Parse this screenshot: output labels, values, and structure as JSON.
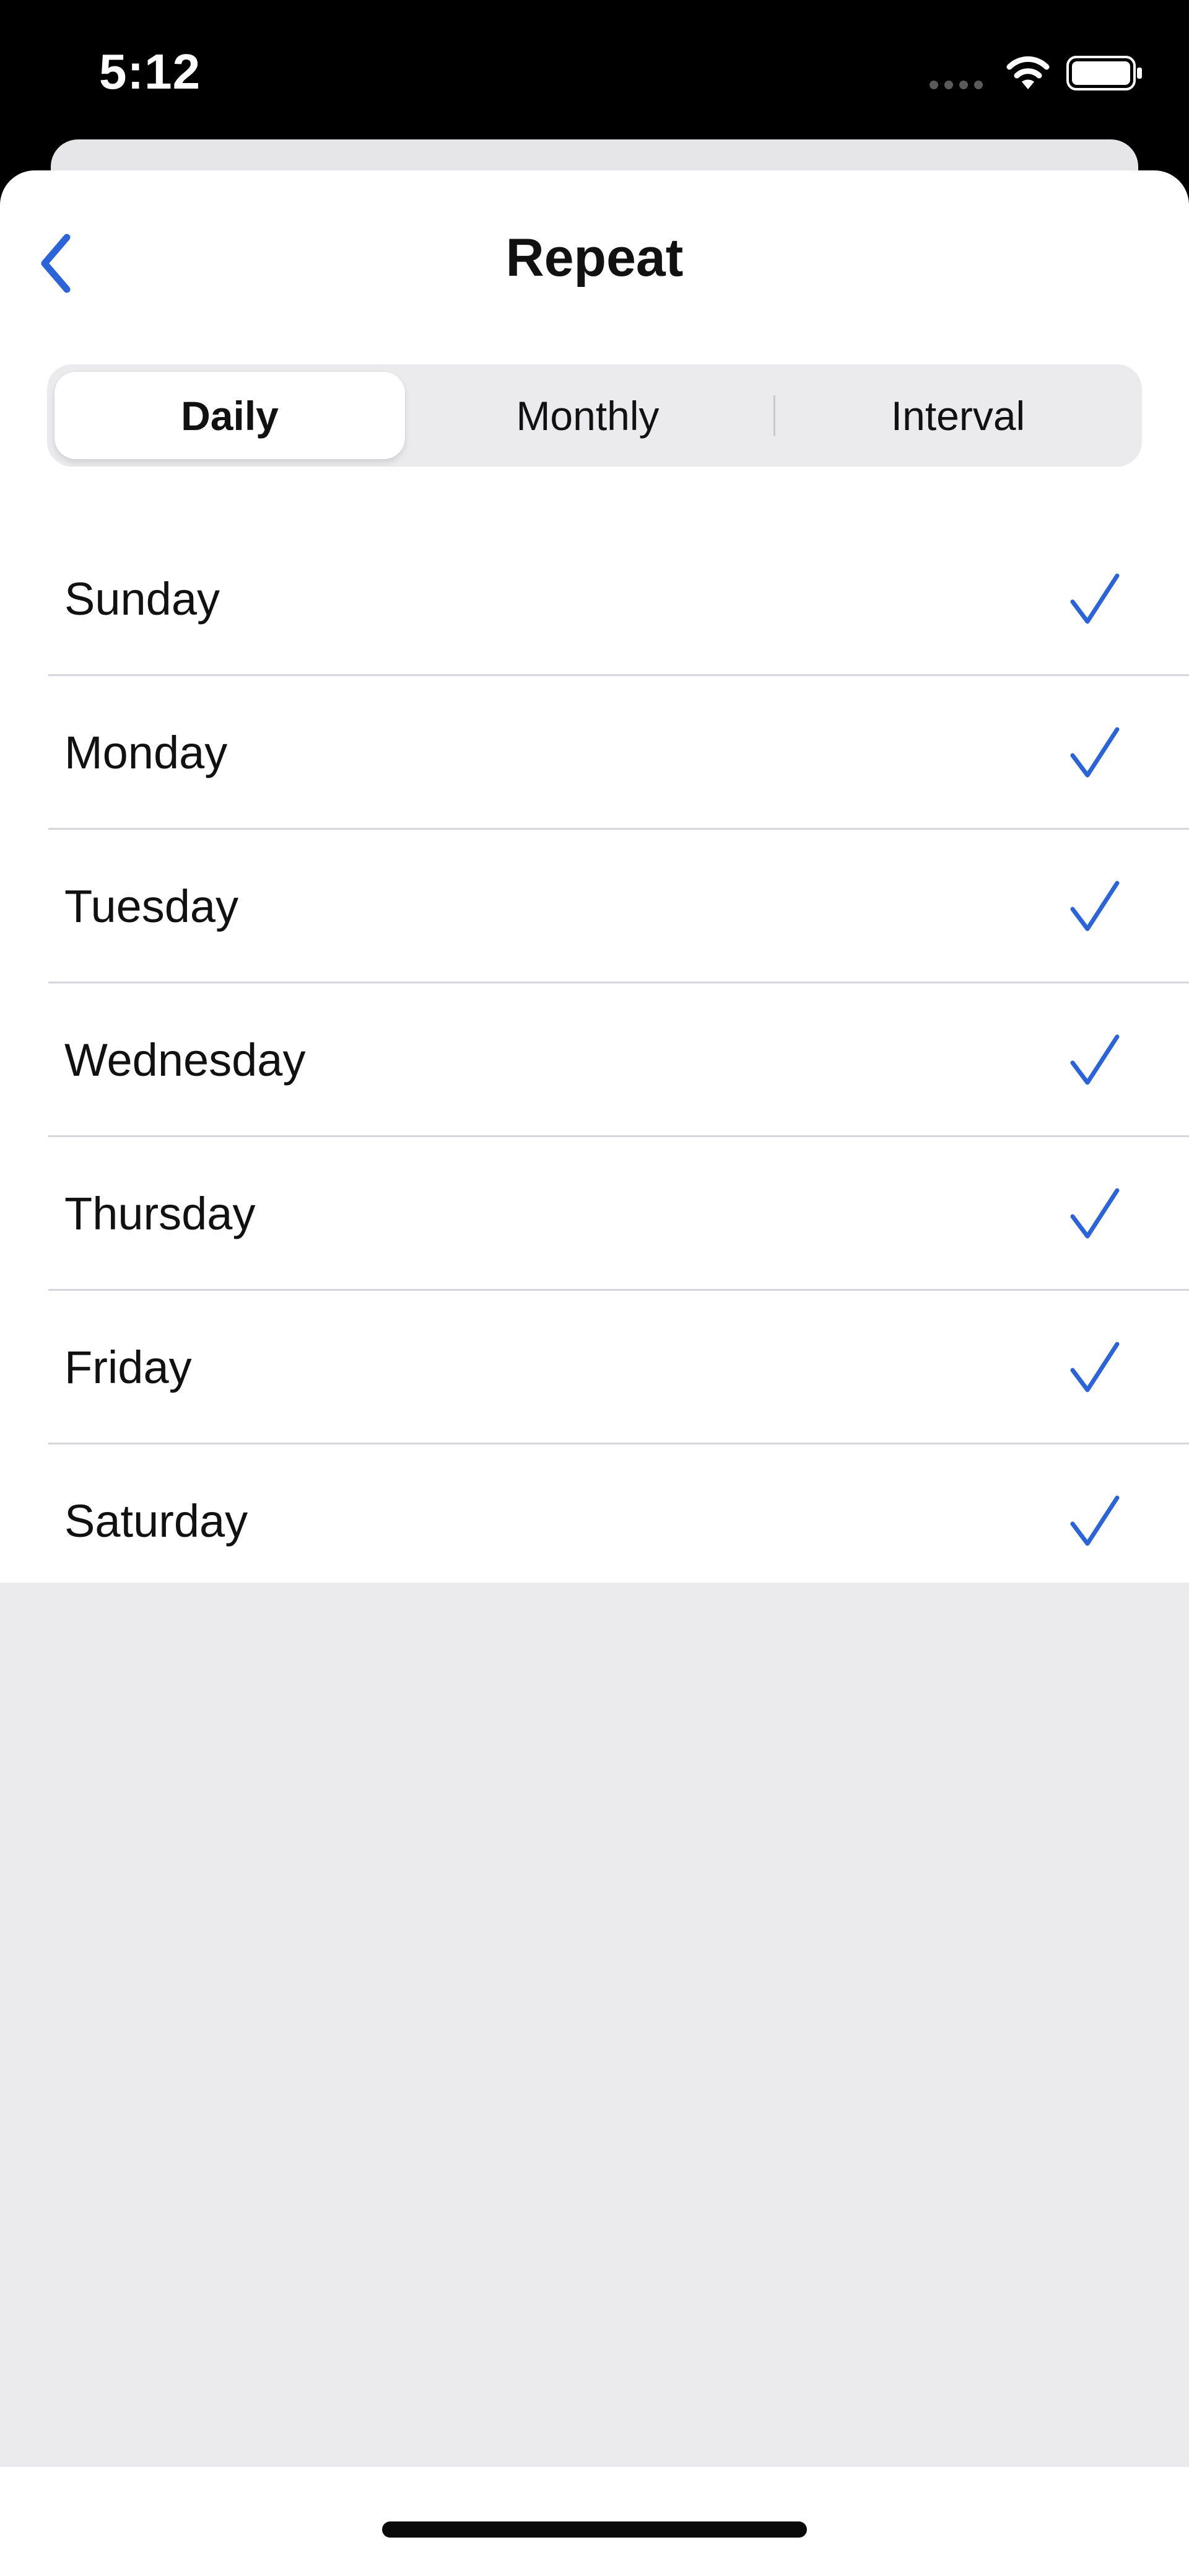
{
  "status_bar": {
    "time": "5:12"
  },
  "nav": {
    "title": "Repeat",
    "back_icon": "chevron-left-icon"
  },
  "segments": [
    {
      "label": "Daily",
      "selected": true
    },
    {
      "label": "Monthly",
      "selected": false
    },
    {
      "label": "Interval",
      "selected": false
    }
  ],
  "days": [
    {
      "label": "Sunday",
      "checked": true
    },
    {
      "label": "Monday",
      "checked": true
    },
    {
      "label": "Tuesday",
      "checked": true
    },
    {
      "label": "Wednesday",
      "checked": true
    },
    {
      "label": "Thursday",
      "checked": true
    },
    {
      "label": "Friday",
      "checked": true
    },
    {
      "label": "Saturday",
      "checked": true
    }
  ],
  "colors": {
    "accent": "#2b63d9",
    "background": "#ebebed",
    "divider": "#d6d6d8"
  }
}
